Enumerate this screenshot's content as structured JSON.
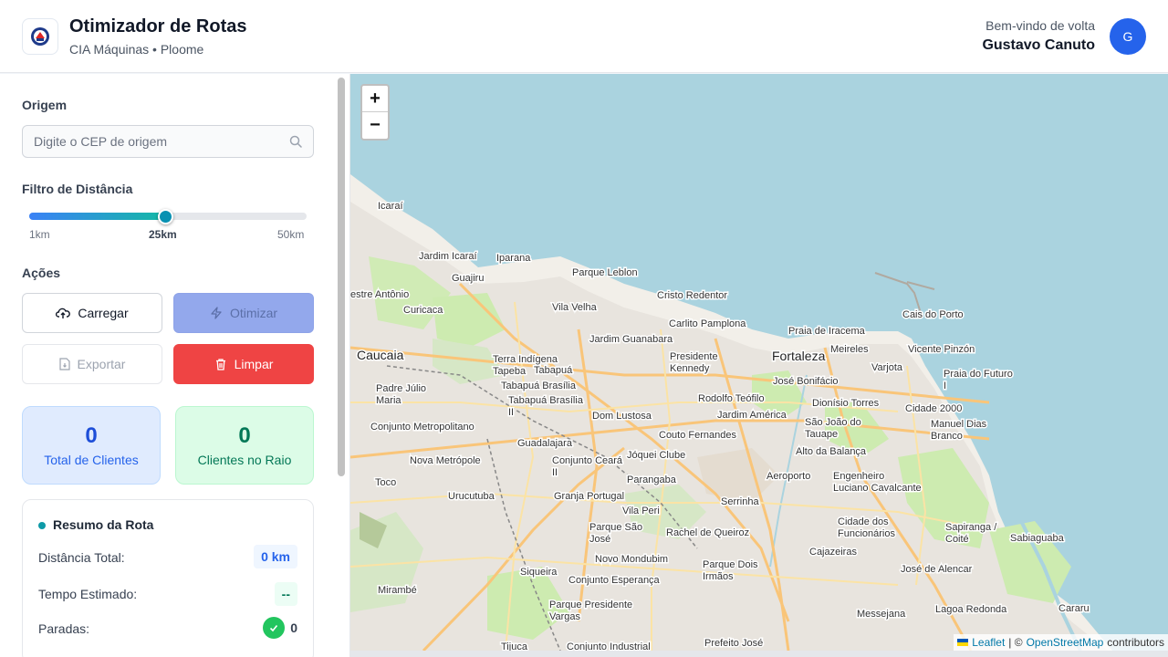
{
  "header": {
    "title": "Otimizador de Rotas",
    "subtitle": "CIA Máquinas • Ploome",
    "welcome": "Bem-vindo de volta",
    "user_name": "Gustavo Canuto",
    "avatar_initial": "G"
  },
  "sidebar": {
    "origin": {
      "label": "Origem",
      "placeholder": "Digite o CEP de origem",
      "value": ""
    },
    "distance_filter": {
      "label": "Filtro de Distância",
      "min_label": "1km",
      "current_label": "25km",
      "max_label": "50km",
      "min": 1,
      "max": 50,
      "value": 25
    },
    "actions": {
      "label": "Ações",
      "load": "Carregar",
      "optimize": "Otimizar",
      "export": "Exportar",
      "clear": "Limpar"
    },
    "stats": {
      "total_clients_value": "0",
      "total_clients_label": "Total de Clientes",
      "clients_in_radius_value": "0",
      "clients_in_radius_label": "Clientes no Raio"
    },
    "route_summary": {
      "title": "Resumo da Rota",
      "distance_label": "Distância Total:",
      "distance_value": "0 km",
      "time_label": "Tempo Estimado:",
      "time_value": "--",
      "stops_label": "Paradas:",
      "stops_value": "0"
    }
  },
  "map": {
    "zoom_in": "+",
    "zoom_out": "−",
    "attribution_leaflet": "Leaflet",
    "attribution_sep": "| ©",
    "attribution_osm": "OpenStreetMap",
    "attribution_suffix": "contributors",
    "places": [
      "Icaraí",
      "Jardim Icaraí",
      "Iparana",
      "Parque Leblon",
      "Guajiru",
      "estre Antônio",
      "Curicaca",
      "Vila Velha",
      "Cristo Redentor",
      "Carlito Pamplona",
      "Praia de Iracema",
      "Cais do Porto",
      "Jardim Guanabara",
      "Presidente Kennedy",
      "Fortaleza",
      "Meireles",
      "Vicente Pinzón",
      "Caucaia",
      "Terra Indígena Tapeba",
      "Tabapuá",
      "Varjota",
      "Praia do Futuro I",
      "Padre Júlio Maria",
      "Tabapuá Brasília",
      "José Bonifácio",
      "Rodolfo Teófilo",
      "Dionísio Torres",
      "Tabapuá Brasília II",
      "Dom Lustosa",
      "Jardim América",
      "Cidade 2000",
      "Conjunto Metropolitano",
      "São João do Tauape",
      "Manuel Dias Branco",
      "Couto Fernandes",
      "Guadalajara",
      "Jóquei Clube",
      "Alto da Balança",
      "Nova Metrópole",
      "Conjunto Ceará II",
      "Toco",
      "Parangaba",
      "Aeroporto",
      "Engenheiro Luciano Cavalcante",
      "Urucutuba",
      "Granja Portugal",
      "Serrinha",
      "Vila Peri",
      "Parque São José",
      "Rachel de Queiroz",
      "Cidade dos Funcionários",
      "Sapiranga / Coité",
      "Sabiaguaba",
      "Cajazeiras",
      "Novo Mondubim",
      "Siqueira",
      "Parque Dois Irmãos",
      "José de Alencar",
      "Conjunto Esperança",
      "Mirambé",
      "Parque Presidente Vargas",
      "Lagoa Redonda",
      "Messejana",
      "Cararu",
      "Tijuca",
      "Conjunto Industrial",
      "Prefeito José"
    ]
  },
  "colors": {
    "primary": "#2563eb",
    "danger": "#ef4444",
    "success": "#22c55e",
    "teal": "#0891b2",
    "sea": "#aad3df"
  }
}
